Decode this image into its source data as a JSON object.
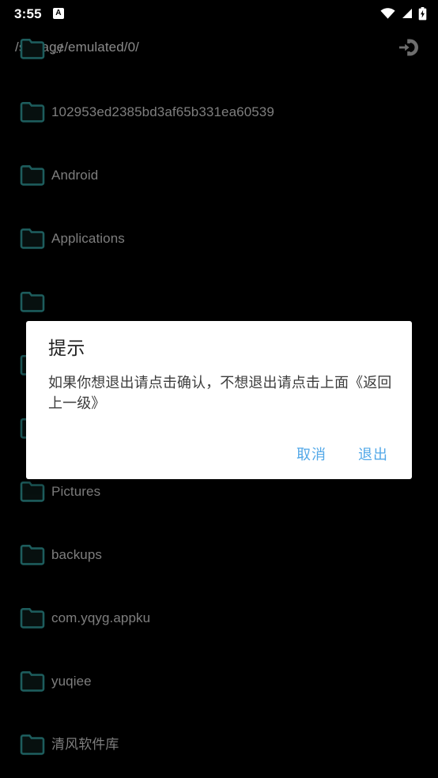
{
  "status_bar": {
    "time": "3:55",
    "notification_badge_label": "A",
    "icons": [
      "wifi-icon",
      "cellular-signal-icon",
      "battery-charging-icon"
    ]
  },
  "toolbar": {
    "path": "/storage/emulated/0/",
    "exit_icon": "exit-to-app-icon"
  },
  "file_list": {
    "items": [
      {
        "name": "../",
        "icon": "folder-icon"
      },
      {
        "name": "102953ed2385bd3af65b331ea60539",
        "icon": "folder-icon"
      },
      {
        "name": "Android",
        "icon": "folder-icon"
      },
      {
        "name": "Applications",
        "icon": "folder-icon"
      },
      {
        "name": "",
        "icon": "folder-icon"
      },
      {
        "name": "",
        "icon": "folder-icon"
      },
      {
        "name": "",
        "icon": "folder-icon"
      },
      {
        "name": "Pictures",
        "icon": "folder-icon"
      },
      {
        "name": "backups",
        "icon": "folder-icon"
      },
      {
        "name": "com.yqyg.appku",
        "icon": "folder-icon"
      },
      {
        "name": "yuqiee",
        "icon": "folder-icon"
      },
      {
        "name": "清风软件库",
        "icon": "folder-icon"
      }
    ]
  },
  "dialog": {
    "title": "提示",
    "message": "如果你想退出请点击确认，不想退出请点击上面《返回上一级》",
    "cancel_label": "取消",
    "confirm_label": "退出",
    "accent_color": "#52a8e8",
    "background_color": "#ffffff"
  },
  "theme": {
    "background": "#000000",
    "text_color": "#7e7e7e",
    "folder_color": "#1d5c5c"
  }
}
